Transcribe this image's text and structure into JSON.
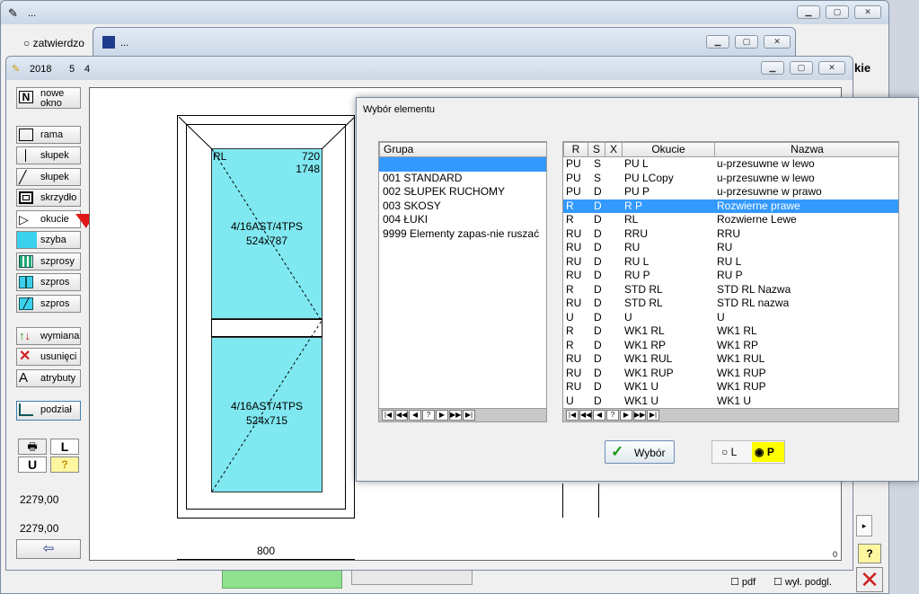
{
  "win_back": {
    "title": "...",
    "radio_label": "zatwierdzo",
    "right_label": "kie"
  },
  "win_mid": {
    "title": "..."
  },
  "win_main": {
    "year": "2018",
    "n1": "5",
    "n2": "4"
  },
  "toolbar": [
    {
      "name": "nowe-okno-button",
      "label": "nowe\nokno",
      "icon": "N-icon"
    },
    {
      "name": "rama-button",
      "label": "rama",
      "icon": "frame-icon"
    },
    {
      "name": "slupek-button",
      "label": "słupek",
      "icon": "vertical-line-icon"
    },
    {
      "name": "slupek-diag-button",
      "label": "słupek",
      "icon": "diagonal-line-icon"
    },
    {
      "name": "skrzydlo-button",
      "label": "skrzydło",
      "icon": "sash-icon"
    },
    {
      "name": "okucie-button",
      "label": "okucie",
      "icon": "hinge-triangle-icon"
    },
    {
      "name": "szyba-button",
      "label": "szyba",
      "icon": "glass-icon"
    },
    {
      "name": "szprosy-button",
      "label": "szprosy",
      "icon": "grid-icon"
    },
    {
      "name": "szpros-button",
      "label": "szpros",
      "icon": "bars-icon"
    },
    {
      "name": "szpros2-button",
      "label": "szpros",
      "icon": "hatch-icon"
    },
    {
      "name": "wymiana-button",
      "label": "wymiana",
      "icon": "swap-arrows-icon"
    },
    {
      "name": "usuniecie-button",
      "label": "usunięci",
      "icon": "red-x-icon"
    },
    {
      "name": "atrybuty-button",
      "label": "atrybuty",
      "icon": "letter-a-icon"
    },
    {
      "name": "podzial-button",
      "label": "podział",
      "icon": "split-icon"
    }
  ],
  "small_buttons": {
    "print": "print-icon",
    "L": "L",
    "U": "U",
    "help": "?"
  },
  "values": {
    "v1": "2279,00",
    "v2": "2279,00"
  },
  "drawing": {
    "label_rl": "RL",
    "dim_top_w": "720",
    "dim_top_h": "1748",
    "top_glass": "4/16AST/4TPS",
    "top_size": "524x787",
    "bottom_glass": "4/16AST/4TPS",
    "bottom_size": "524x715",
    "width_label": "800",
    "corner_zero": "0"
  },
  "dialog": {
    "title": "Wybór elementu",
    "group_header": "Grupa",
    "groups": [
      "",
      "001 STANDARD",
      "002 SŁUPEK RUCHOMY",
      "003 SKOSY",
      "004 ŁUKI",
      "9999 Elementy zapas-nie ruszać"
    ],
    "columns": {
      "r": "R",
      "s": "S",
      "x": "X",
      "okucie": "Okucie",
      "nazwa": "Nazwa"
    },
    "rows": [
      {
        "r": "PU",
        "s": "S",
        "okucie": "PU L",
        "nazwa": "u-przesuwne w lewo"
      },
      {
        "r": "PU",
        "s": "S",
        "okucie": "PU LCopy",
        "nazwa": "u-przesuwne w lewo"
      },
      {
        "r": "PU",
        "s": "D",
        "okucie": "PU P",
        "nazwa": "u-przesuwne w prawo"
      },
      {
        "r": "R",
        "s": "D",
        "okucie": "R P",
        "nazwa": "Rozwierne prawe",
        "selected": true
      },
      {
        "r": "R",
        "s": "D",
        "okucie": "RL",
        "nazwa": "Rozwierne Lewe"
      },
      {
        "r": "RU",
        "s": "D",
        "okucie": "RRU",
        "nazwa": "RRU"
      },
      {
        "r": "RU",
        "s": "D",
        "okucie": "RU",
        "nazwa": "RU"
      },
      {
        "r": "RU",
        "s": "D",
        "okucie": "RU L",
        "nazwa": "RU L"
      },
      {
        "r": "RU",
        "s": "D",
        "okucie": "RU P",
        "nazwa": "RU P"
      },
      {
        "r": "R",
        "s": "D",
        "okucie": "STD RL",
        "nazwa": "STD RL Nazwa"
      },
      {
        "r": "RU",
        "s": "D",
        "okucie": "STD RL",
        "nazwa": "STD RL nazwa"
      },
      {
        "r": "U",
        "s": "D",
        "okucie": "U",
        "nazwa": "U"
      },
      {
        "r": "R",
        "s": "D",
        "okucie": "WK1 RL",
        "nazwa": "WK1 RL"
      },
      {
        "r": "R",
        "s": "D",
        "okucie": "WK1 RP",
        "nazwa": "WK1 RP"
      },
      {
        "r": "RU",
        "s": "D",
        "okucie": "WK1 RUL",
        "nazwa": "WK1 RUL"
      },
      {
        "r": "RU",
        "s": "D",
        "okucie": "WK1 RUP",
        "nazwa": "WK1 RUP"
      },
      {
        "r": "RU",
        "s": "D",
        "okucie": "WK1 U",
        "nazwa": "WK1 RUP"
      },
      {
        "r": "U",
        "s": "D",
        "okucie": "WK1 U",
        "nazwa": "WK1 U"
      }
    ],
    "nav_buttons": [
      "|◀",
      "◀◀",
      "◀",
      "?",
      "▶",
      "▶▶",
      "▶|"
    ],
    "wybor_label": "Wybór",
    "radio_l": "L",
    "radio_p": "P"
  },
  "bottom": {
    "pdf_label": "pdf",
    "wyl_label": "wył. podgl."
  }
}
